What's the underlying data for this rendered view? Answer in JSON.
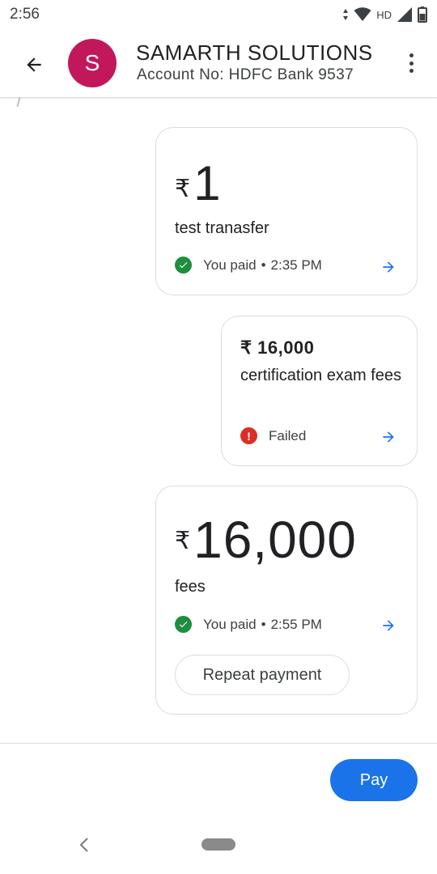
{
  "status_bar": {
    "time": "2:56",
    "network_label": "HD",
    "icons": [
      "data-arrows-icon",
      "wifi-icon",
      "signal-icon",
      "battery-icon"
    ]
  },
  "header": {
    "back_icon": "arrow-back-icon",
    "avatar_letter": "S",
    "avatar_color": "#c2185b",
    "contact_name": "SAMARTH SOLUTIONS",
    "account_no": "Account No: HDFC Bank 9537",
    "menu_icon": "more-vert-icon"
  },
  "transactions": [
    {
      "currency": "₹",
      "amount": "1",
      "note": "test tranasfer",
      "status_text": "You paid",
      "separator": "•",
      "time": "2:35 PM",
      "status": "success"
    },
    {
      "currency": "₹",
      "amount": "₹ 16,000",
      "note": "certification exam fees",
      "status_text": "Failed",
      "status": "failed"
    },
    {
      "currency": "₹",
      "amount": "16,000",
      "note": "fees",
      "status_text": "You paid",
      "separator": "•",
      "time": "2:55 PM",
      "status": "success",
      "action_label": "Repeat payment"
    }
  ],
  "footer": {
    "pay_label": "Pay"
  },
  "colors": {
    "accent": "#1a73e8",
    "success": "#1e8e3e",
    "error": "#d93025"
  }
}
